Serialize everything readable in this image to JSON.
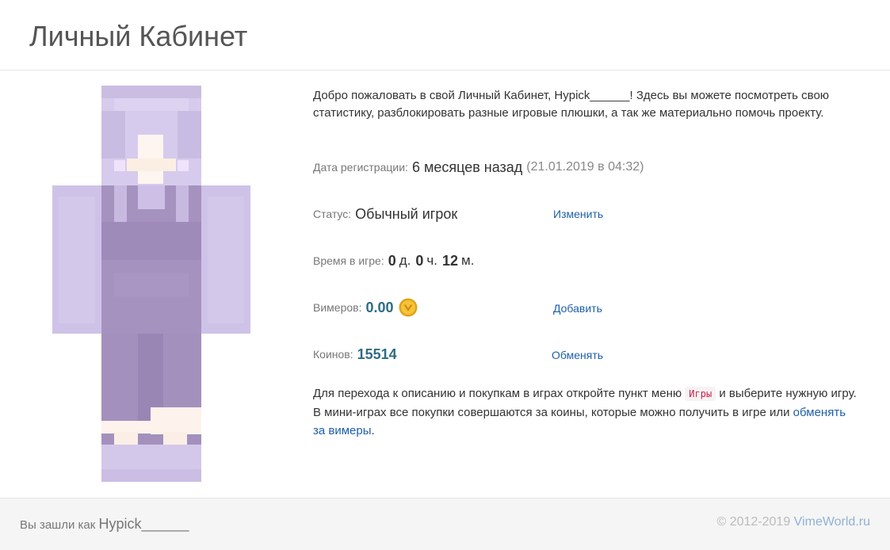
{
  "header": {
    "title": "Личный Кабинет"
  },
  "intro": {
    "before_name": "Добро пожаловать в свой Личный Кабинет, ",
    "username": "Hypick______",
    "after_name": "! Здесь вы можете посмотреть свою статистику, разблокировать разные игровые плюшки, а так же материально помочь проекту."
  },
  "registration": {
    "label": "Дата регистрации:",
    "relative": "6 месяцев назад",
    "exact": "(21.01.2019 в 04:32)"
  },
  "status": {
    "label": "Статус:",
    "value": "Обычный игрок",
    "action": "Изменить"
  },
  "playtime": {
    "label": "Время в игре:",
    "days": "0",
    "days_unit": "д.",
    "hours": "0",
    "hours_unit": "ч.",
    "minutes": "12",
    "minutes_unit": "м."
  },
  "vimers": {
    "label": "Вимеров:",
    "value": "0.00",
    "icon": "vimer-coin-icon",
    "action": "Добавить"
  },
  "coins": {
    "label": "Коинов:",
    "value": "15514",
    "action": "Обменять"
  },
  "outro": {
    "part1": "Для перехода к описанию и покупкам в играх откройте пункт меню ",
    "menu_tag": "Игры",
    "part2": " и выберите нужную игру. В мини-играх все покупки совершаются за коины, которые можно получить в игре или ",
    "link": "обменять за вимеры",
    "part3": "."
  },
  "footer": {
    "logged_as": "Вы зашли как ",
    "username": "Hypick______",
    "copyright": "© 2012-2019 ",
    "site": "VimeWorld.ru"
  },
  "colors": {
    "link": "#1f5fa8",
    "teal_value": "#2f6b82",
    "skin_light": "#cdbfe6",
    "skin_dark": "#a08cba"
  }
}
